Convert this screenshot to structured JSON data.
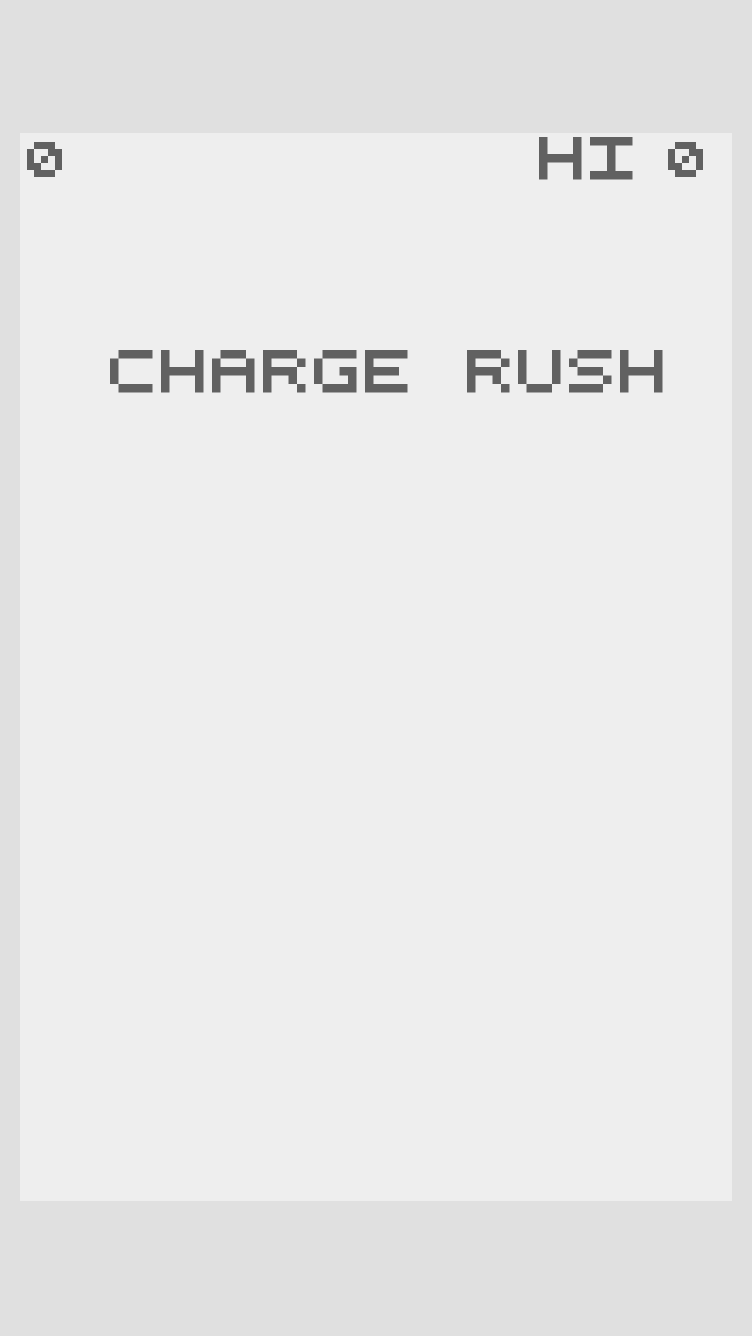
{
  "game": {
    "score": "0",
    "hi_label": "HI",
    "hi_score": "0",
    "title": "CHARGE RUSH"
  },
  "colors": {
    "page_background": "#e0e0e0",
    "canvas_background": "#eeeeee",
    "text": "#616161"
  }
}
